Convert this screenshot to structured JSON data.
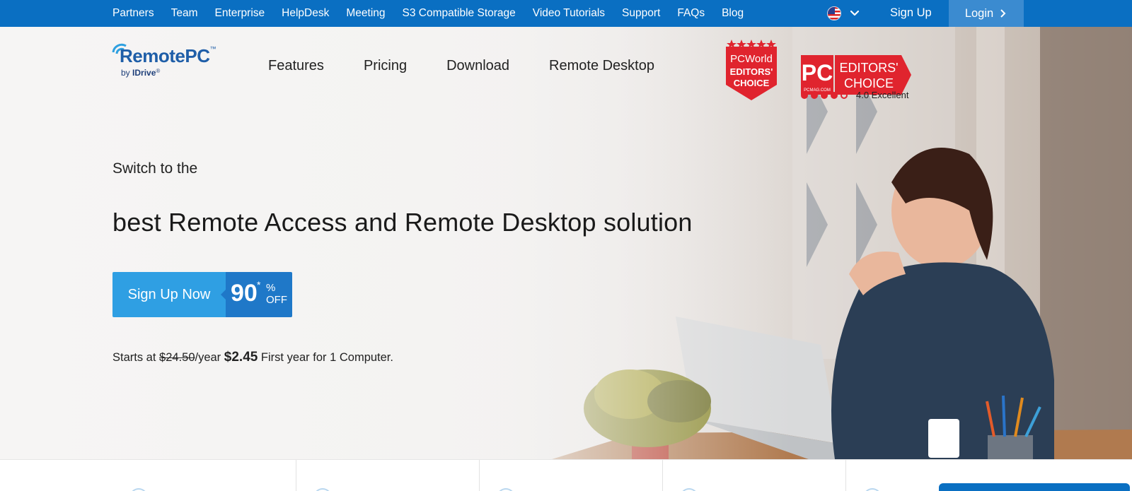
{
  "topbar": {
    "links": [
      "Partners",
      "Team",
      "Enterprise",
      "HelpDesk",
      "Meeting",
      "S3 Compatible Storage",
      "Video Tutorials",
      "Support",
      "FAQs",
      "Blog"
    ],
    "signup_label": "Sign Up",
    "login_label": "Login"
  },
  "logo": {
    "brand": "RemotePC",
    "tm": "™",
    "by": "by",
    "company": "IDrive",
    "reg": "®"
  },
  "mainnav": [
    "Features",
    "Pricing",
    "Download",
    "Remote Desktop"
  ],
  "awards": {
    "pcworld": {
      "line1": "PCWorld",
      "line2": "EDITORS'",
      "line3": "CHOICE"
    },
    "pcmag": {
      "logo": "PC",
      "sub": "PCMAG.COM",
      "line1": "EDITORS'",
      "line2": "CHOICE",
      "rating_text": "4.0 Excellent",
      "rating": 4,
      "rating_max": 5
    }
  },
  "hero": {
    "kicker": "Switch to the",
    "title": "best Remote Access and Remote Desktop solution",
    "cta_label": "Sign Up Now",
    "discount_number": "90",
    "discount_star": "*",
    "discount_percent": "%",
    "discount_off": "OFF",
    "price_prefix": "Starts at ",
    "old_price": "$24.50",
    "per_year": "/year ",
    "new_price": "$2.45",
    "price_suffix": " First year for 1 Computer."
  },
  "colors": {
    "topbar": "#0a6fc2",
    "cta_main": "#2f9fe3",
    "cta_off": "#1f78c8",
    "award_red": "#e0242e"
  }
}
